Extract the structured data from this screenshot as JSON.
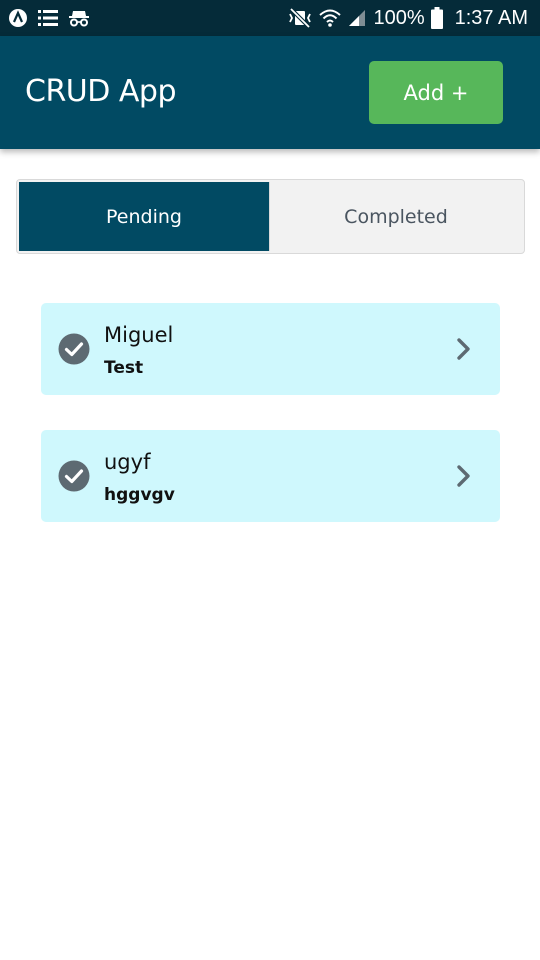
{
  "status_bar": {
    "left_icons": [
      "android-icon",
      "list-icon",
      "incognito-icon"
    ],
    "right_icons": [
      "vibrate-mute-icon",
      "wifi-icon",
      "signal-icon",
      "battery-icon"
    ],
    "battery": "100%",
    "time": "1:37 AM"
  },
  "app_bar": {
    "title": "CRUD App",
    "add_label": "Add +"
  },
  "tabs": {
    "pending": "Pending",
    "completed": "Completed",
    "active": "pending"
  },
  "tasks": [
    {
      "title": "Miguel",
      "subtitle": "Test"
    },
    {
      "title": "ugyf",
      "subtitle": "hggvgv"
    }
  ],
  "colors": {
    "status_bar": "#052b39",
    "app_bar": "#014a63",
    "add_button": "#57b75a",
    "card": "#cff8fd",
    "icon": "#5d6a72"
  }
}
